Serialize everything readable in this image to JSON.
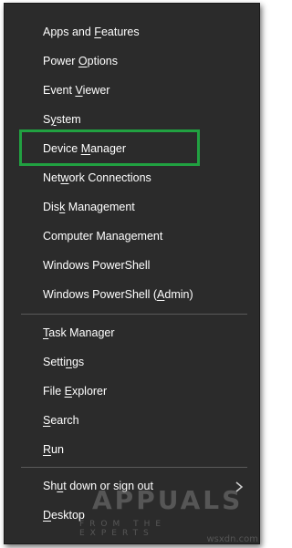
{
  "menu": {
    "items": [
      {
        "label": "Apps and Features",
        "underline_char": "F"
      },
      {
        "label": "Power Options",
        "underline_char": "O"
      },
      {
        "label": "Event Viewer",
        "underline_char": "V"
      },
      {
        "label": "System",
        "underline_char": "y"
      },
      {
        "label": "Device Manager",
        "underline_char": "M"
      },
      {
        "label": "Network Connections",
        "underline_char": "w"
      },
      {
        "label": "Disk Management",
        "underline_char": "k"
      },
      {
        "label": "Computer Management",
        "underline_char": "G"
      },
      {
        "label": "Windows PowerShell",
        "underline_char": "I"
      },
      {
        "label": "Windows PowerShell (Admin)",
        "underline_char": "A"
      },
      {
        "label": "Task Manager",
        "underline_char": "T"
      },
      {
        "label": "Settings",
        "underline_char": "n"
      },
      {
        "label": "File Explorer",
        "underline_char": "E"
      },
      {
        "label": "Search",
        "underline_char": "S"
      },
      {
        "label": "Run",
        "underline_char": "R"
      },
      {
        "label": "Shut down or sign out",
        "underline_char": "u"
      },
      {
        "label": "Desktop",
        "underline_char": "D"
      }
    ],
    "highlighted_item": "Device Manager",
    "submenu_arrow_icon": "chevron-right-icon"
  },
  "watermark": {
    "text": "APPUALS",
    "subtext": "FROM THE EXPERTS"
  },
  "credit": "wsxdn.com",
  "colors": {
    "menu_bg": "#2b2b2b",
    "text": "#ffffff",
    "separator": "#5a5a5a",
    "highlight_border": "#21a141"
  }
}
